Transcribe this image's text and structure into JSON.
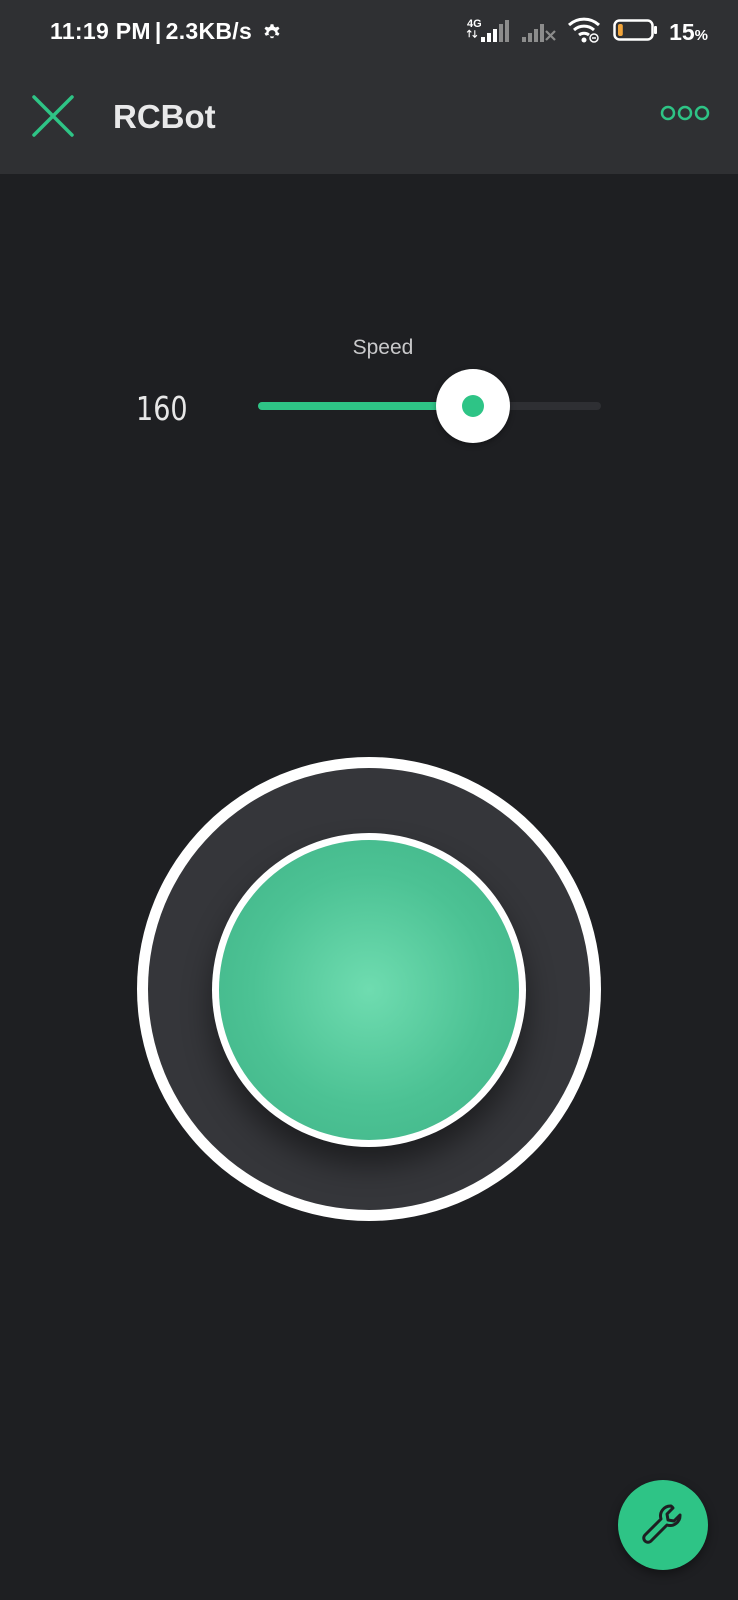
{
  "status_bar": {
    "time": "11:19 PM",
    "separator": "|",
    "network_speed": "2.3KB/s",
    "network_type": "4G",
    "battery_percent": "15",
    "battery_percent_unit": "%",
    "battery_level": 0.15,
    "icons": [
      "settings-gear-icon",
      "signal-4g-icon",
      "signal-no-service-icon",
      "wifi-icon",
      "battery-icon"
    ]
  },
  "app_bar": {
    "title": "RCBot",
    "close_icon": "close-icon",
    "menu_icon": "more-options-icon"
  },
  "speed_slider": {
    "label": "Speed",
    "value_text": "160",
    "value": 160,
    "min": 0,
    "max": 255
  },
  "joystick": {
    "x": 0,
    "y": 0
  },
  "fab": {
    "icon": "wrench-icon"
  },
  "colors": {
    "accent": "#2ec486",
    "background": "#1e1f22",
    "bar": "#2f3033",
    "joystick_ring": "#35363a"
  }
}
